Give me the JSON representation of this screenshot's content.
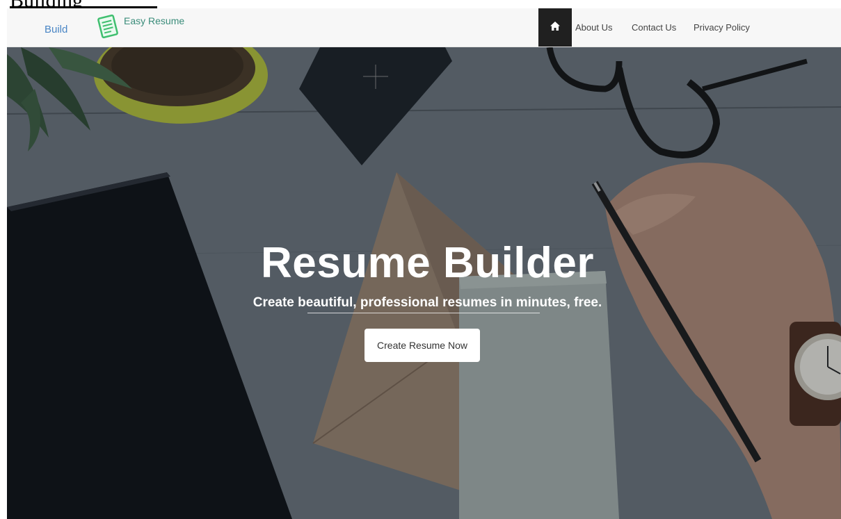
{
  "top_fragment": {
    "text": "Building"
  },
  "navbar": {
    "brand_prefix": "Build",
    "brand_name": "Easy Resume",
    "home_icon": "home-icon",
    "links": [
      {
        "label": "About Us"
      },
      {
        "label": "Contact Us"
      },
      {
        "label": "Privacy Policy"
      }
    ]
  },
  "hero": {
    "title": "Resume Builder",
    "subtitle": "Create beautiful, professional resumes in minutes, free.",
    "cta_label": "Create Resume Now"
  },
  "colors": {
    "navbar_bg": "#f7f7f7",
    "home_button_bg": "#202020",
    "brand_text": "#3a8c7a",
    "brand_prefix": "#4a86c5",
    "logo_green": "#3fbf6f"
  }
}
